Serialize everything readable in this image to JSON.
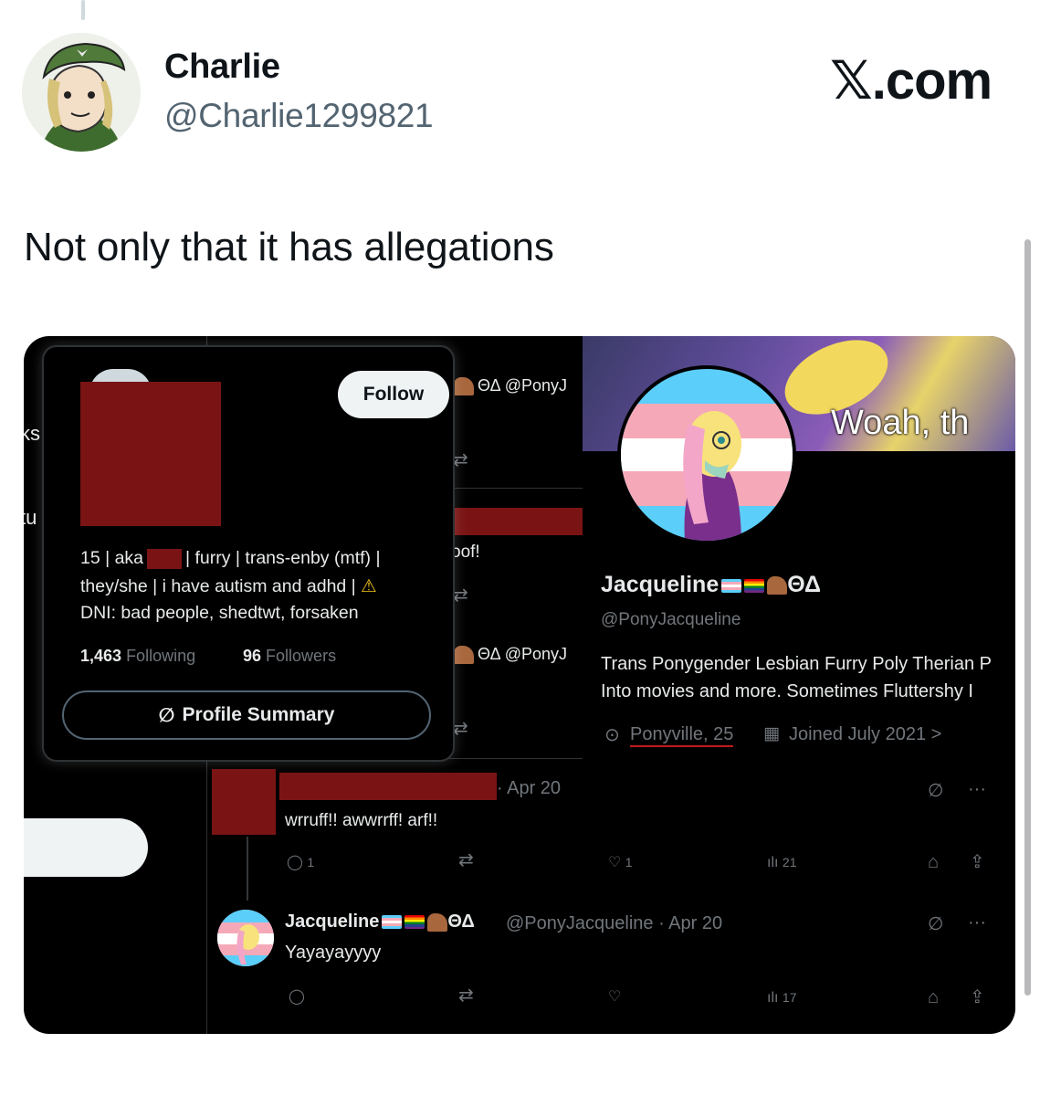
{
  "tweet": {
    "author_name": "Charlie",
    "author_handle": "@Charlie1299821",
    "watermark": "𝕏.com",
    "text": "Not only that it has allegations"
  },
  "screenshot": {
    "left_edge_fragments": [
      "ks",
      "tu"
    ],
    "hover_card": {
      "follow_label": "Follow",
      "bio_line1": "15 | aka",
      "bio_line1_rest": "| furry | trans-enby (mtf) |",
      "bio_line2": "they/she | i have autism and adhd |",
      "bio_line3": "DNI: bad people, shedtwt, forsaken",
      "following_count": "1,463",
      "following_label": "Following",
      "followers_count": "96",
      "followers_label": "Followers",
      "summary_label": "Profile Summary",
      "warning_icon": "warning-icon"
    },
    "middle_column": {
      "handle_fragment_1": "ΘΔ @PonyJ",
      "reply_fragment": "oof!",
      "handle_fragment_2": "ΘΔ @PonyJ"
    },
    "profile": {
      "banner_text": "Woah, th",
      "display_name": "Jacqueline",
      "name_suffix": "ΘΔ",
      "handle": "@PonyJacqueline",
      "bio_line1": "Trans Ponygender Lesbian Furry Poly Therian P",
      "bio_line2": "Into movies and more. Sometimes Fluttershy I",
      "location": "Ponyville, 25",
      "joined": "Joined July 2021",
      "joined_chevron": ">"
    },
    "reply_tweet": {
      "date": "· Apr 20",
      "text": "wrruff!! awwrrff! arf!!",
      "reply_count": "1",
      "like_count": "1",
      "view_count": "21"
    },
    "jacq_tweet": {
      "name": "Jacqueline",
      "name_suffix": "ΘΔ",
      "handle_date": "@PonyJacqueline · Apr 20",
      "text": "Yayayayyyy",
      "view_count": "17",
      "more": "···"
    },
    "colors": {
      "redaction": "#7a1414",
      "card_bg": "#000000",
      "grey_text": "#71767b"
    }
  }
}
